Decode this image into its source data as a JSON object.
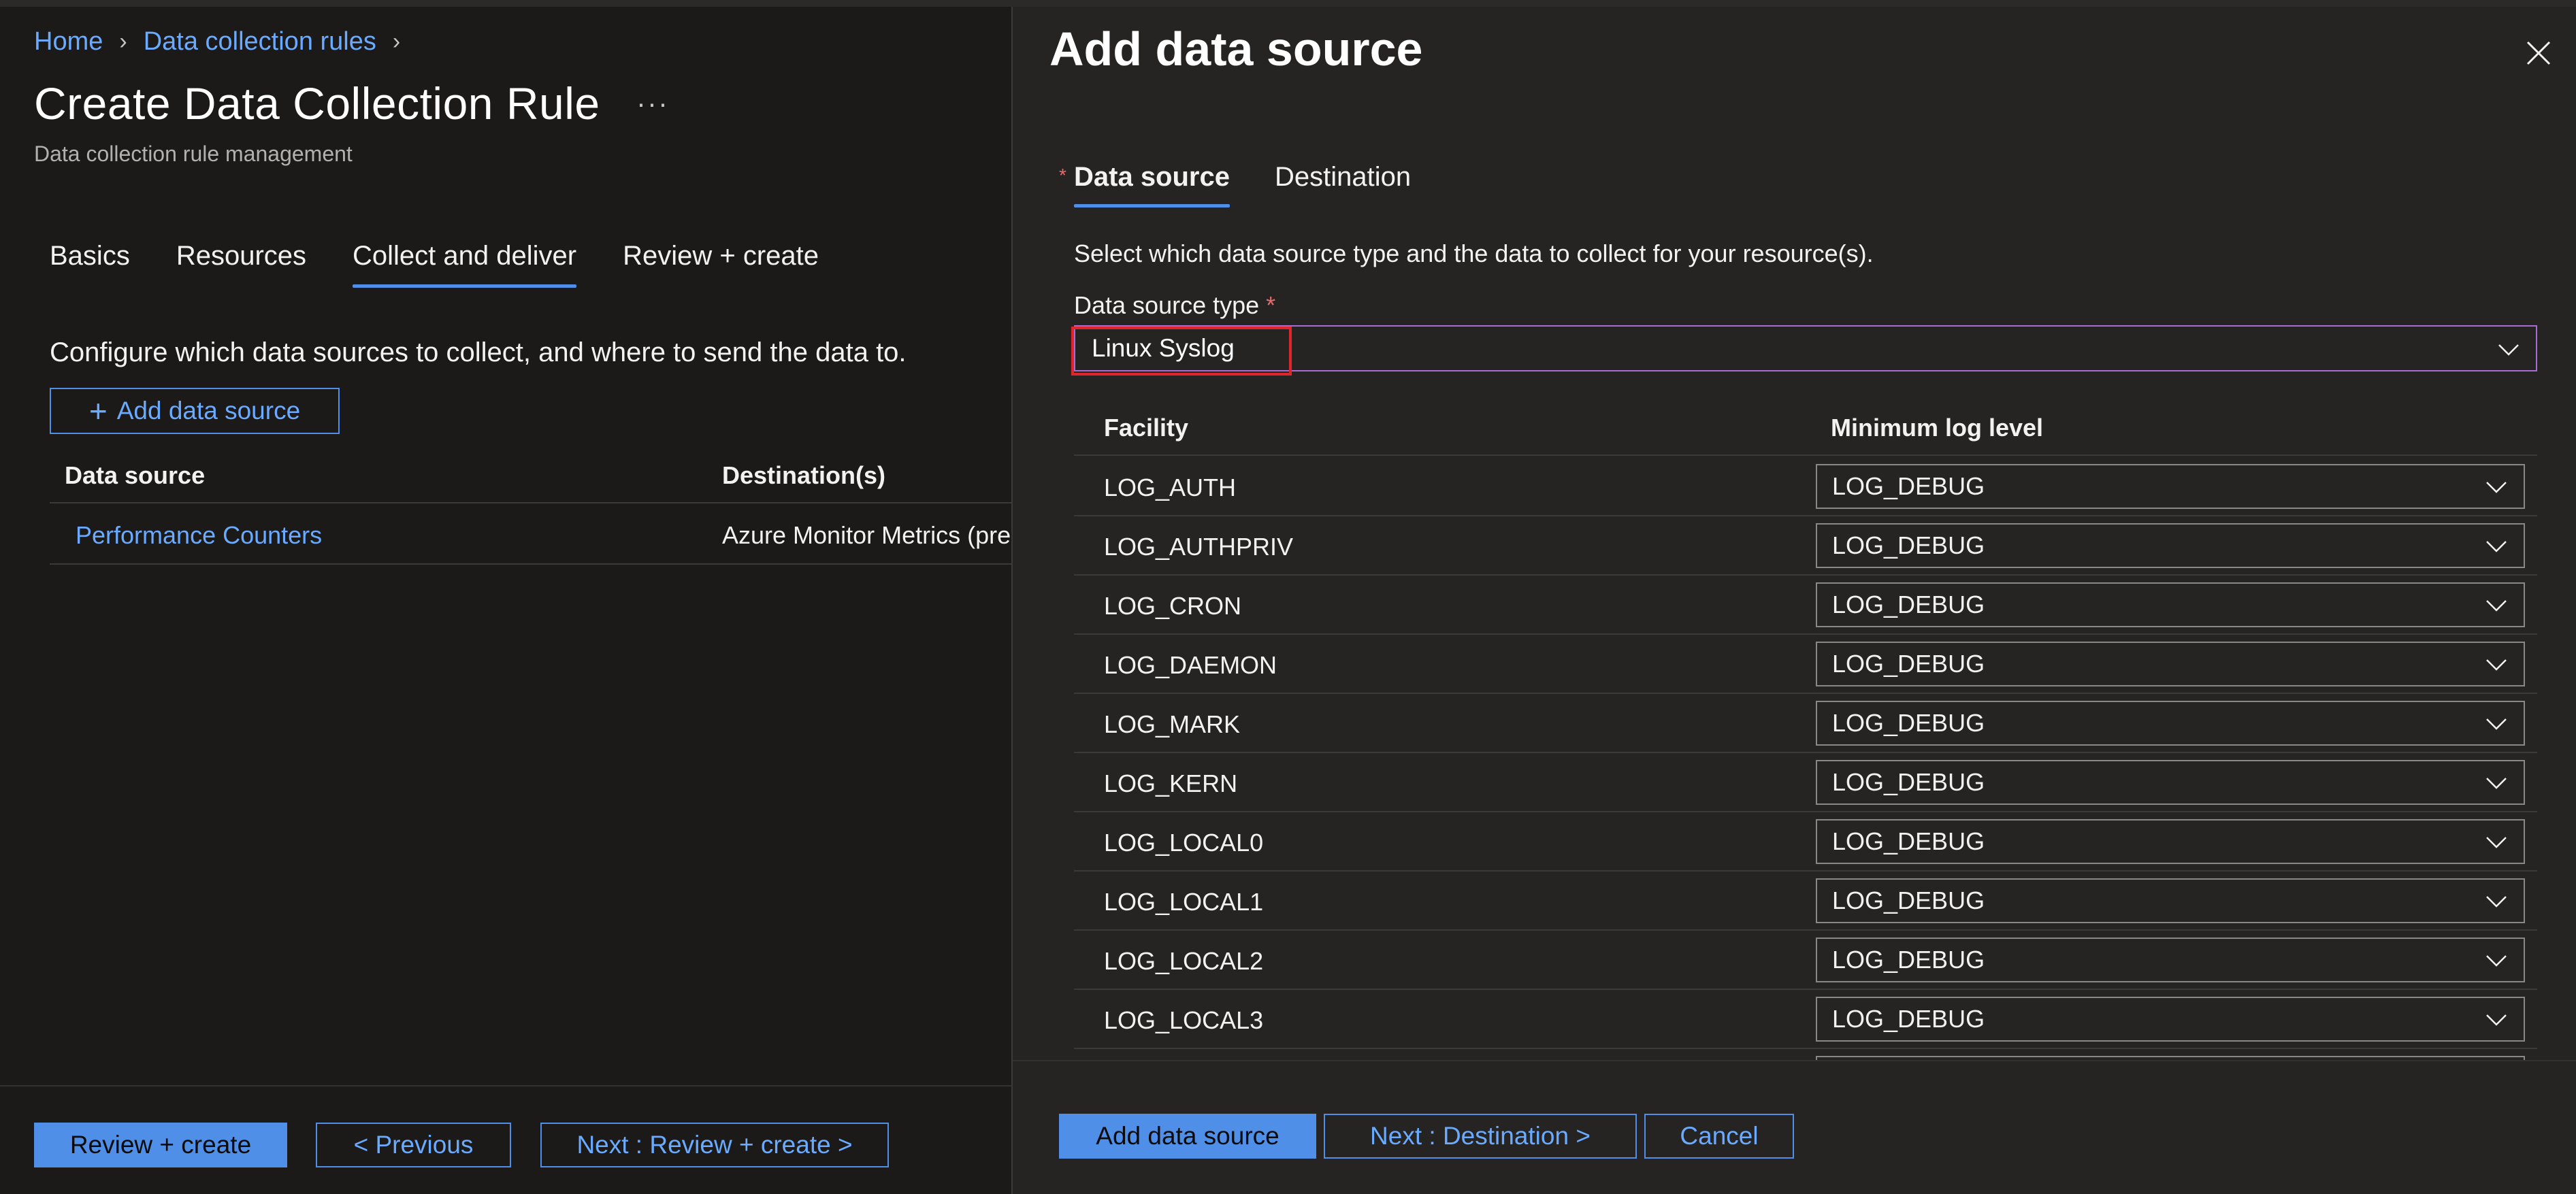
{
  "breadcrumb": [
    {
      "label": "Home"
    },
    {
      "label": "Data collection rules"
    }
  ],
  "page": {
    "title": "Create Data Collection Rule",
    "more_label": "···",
    "subtitle": "Data collection rule management"
  },
  "wizard_tabs": [
    {
      "label": "Basics",
      "active": false
    },
    {
      "label": "Resources",
      "active": false
    },
    {
      "label": "Collect and deliver",
      "active": true
    },
    {
      "label": "Review + create",
      "active": false
    }
  ],
  "collect": {
    "description": "Configure which data sources to collect, and where to send the data to.",
    "add_button_label": "Add data source",
    "columns": [
      "Data source",
      "Destination(s)"
    ],
    "rows": [
      {
        "data_source": "Performance Counters",
        "destinations": "Azure Monitor Metrics (pre"
      }
    ]
  },
  "left_footer": {
    "review_create": "Review + create",
    "previous": "< Previous",
    "next": "Next : Review + create >"
  },
  "panel": {
    "title": "Add data source",
    "tabs": [
      {
        "label": "Data source",
        "active": true,
        "required": true
      },
      {
        "label": "Destination",
        "active": false
      }
    ],
    "description": "Select which data source type and the data to collect for your resource(s).",
    "ds_type_label": "Data source type",
    "ds_type_required": "*",
    "ds_type_value": "Linux Syslog",
    "table_columns": [
      "Facility",
      "Minimum log level"
    ],
    "facilities": [
      {
        "facility": "LOG_AUTH",
        "level": "LOG_DEBUG"
      },
      {
        "facility": "LOG_AUTHPRIV",
        "level": "LOG_DEBUG"
      },
      {
        "facility": "LOG_CRON",
        "level": "LOG_DEBUG"
      },
      {
        "facility": "LOG_DAEMON",
        "level": "LOG_DEBUG"
      },
      {
        "facility": "LOG_MARK",
        "level": "LOG_DEBUG"
      },
      {
        "facility": "LOG_KERN",
        "level": "LOG_DEBUG"
      },
      {
        "facility": "LOG_LOCAL0",
        "level": "LOG_DEBUG"
      },
      {
        "facility": "LOG_LOCAL1",
        "level": "LOG_DEBUG"
      },
      {
        "facility": "LOG_LOCAL2",
        "level": "LOG_DEBUG"
      },
      {
        "facility": "LOG_LOCAL3",
        "level": "LOG_DEBUG"
      }
    ],
    "footer": {
      "add": "Add data source",
      "next": "Next : Destination >",
      "cancel": "Cancel"
    }
  },
  "colors": {
    "accent": "#4f8fe8",
    "link": "#6aaaff",
    "highlight_box": "#e0262b",
    "select_focus_border": "#a96ad4",
    "background": "#1b1a19",
    "panel_background": "#252423"
  }
}
